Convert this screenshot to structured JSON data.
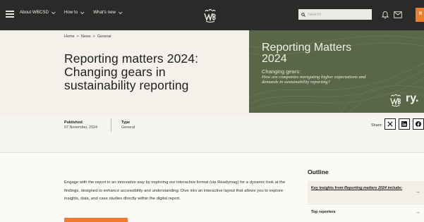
{
  "nav": {
    "items": [
      {
        "label": "About WBCSD"
      },
      {
        "label": "How to"
      },
      {
        "label": "What's new"
      }
    ],
    "search_placeholder": "Search",
    "cta_partial": "R"
  },
  "breadcrumb": [
    "Home",
    ">",
    "News",
    ">",
    "General"
  ],
  "hero": {
    "title": "Reporting matters 2024: Changing gears in sustainability reporting"
  },
  "hero_image": {
    "title": "Reporting Matters 2024",
    "subtitle": "Changing gears:",
    "question": "How are companies navigating higher expectations and demands in sustainability reporting?",
    "partner_mark": "ry."
  },
  "meta": {
    "published_label": "Published",
    "published_value": "07 November, 2024",
    "type_label": "Type",
    "type_value": "General",
    "share_label": "Share:"
  },
  "intro_text": "Engage with the report in an innovative way by exploring our interactive format (via Readymag) for a dynamic look at the findings, designed to enhance accessibility and understanding. Dive into an interactive layout that allows you to explore insights, data, and case studies directly within the digital report.",
  "outline": {
    "title": "Outline",
    "item1_before": "Key insights from ",
    "item1_em": "Reporting matters 2024",
    "item1_after": " include:",
    "item2": "Top reporters",
    "arrow": "→"
  },
  "colors": {
    "topbar": "#2a2a28",
    "accent": "#ef7d2e",
    "hero_image": "#596748"
  }
}
